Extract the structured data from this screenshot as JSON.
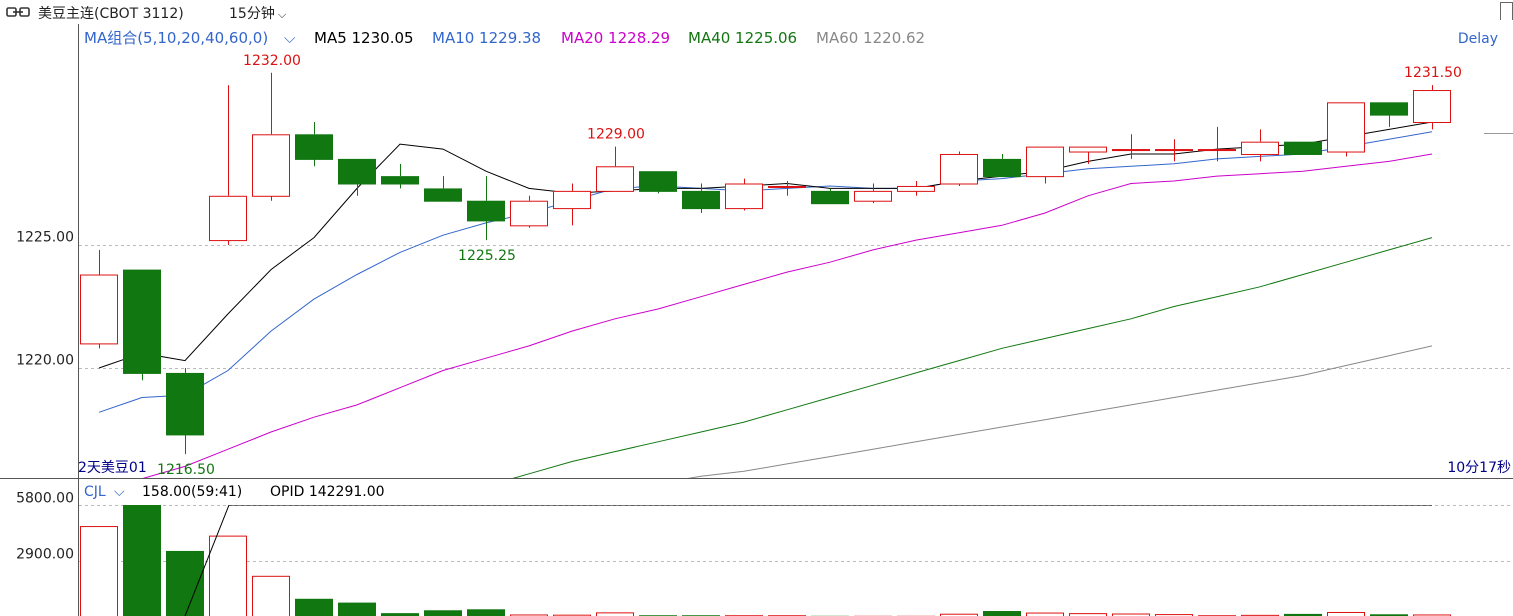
{
  "topbar": {
    "contract_title": "美豆主连(CBOT 3112)",
    "period_label": "15分钟",
    "period_chevron": "⌵",
    "link_icon": "link-icon"
  },
  "colors": {
    "up": "#dd1111",
    "down": "#117711",
    "down_fill": "#117711",
    "grid": "#bbbbbb",
    "ma5": "#000000",
    "ma10": "#3366cc",
    "ma20": "#cc00cc",
    "ma40": "#117711",
    "ma60": "#888888"
  },
  "main_legend": {
    "indicator_label": "MA组合(5,10,20,40,60,0)",
    "chevron": "⌵",
    "items": [
      {
        "key": "ma5",
        "label": "MA5 1230.05",
        "color": "#000000"
      },
      {
        "key": "ma10",
        "label": "MA10 1229.38",
        "color": "#3366cc"
      },
      {
        "key": "ma20",
        "label": "MA20 1228.29",
        "color": "#cc00cc"
      },
      {
        "key": "ma40",
        "label": "MA40 1225.06",
        "color": "#117711"
      },
      {
        "key": "ma60",
        "label": "MA60 1220.62",
        "color": "#888888"
      }
    ],
    "delay_label": "Delay"
  },
  "main_footer": {
    "left_label": "2天美豆01",
    "right_label": "10分17秒"
  },
  "sub_legend": {
    "indicator_label": "CJL",
    "chevron": "⌵",
    "value_text": "158.00(59:41)",
    "opid_text": "OPID 142291.00"
  },
  "chart_data": [
    {
      "type": "candlestick",
      "y_ticks": [
        "1225.00",
        "1220.00"
      ],
      "ylim": [
        1215.5,
        1233.0
      ],
      "annotations": [
        {
          "index": 4,
          "text": "1232.00",
          "kind": "high"
        },
        {
          "index": 9,
          "text": "1225.25",
          "kind": "low"
        },
        {
          "index": 12,
          "text": "1229.00",
          "kind": "high"
        },
        {
          "index": 31,
          "text": "1231.50",
          "kind": "high"
        },
        {
          "index": 2,
          "text": "1216.50",
          "kind": "low"
        }
      ],
      "candles": [
        {
          "o": 1221.0,
          "h": 1224.8,
          "l": 1220.8,
          "c": 1223.8
        },
        {
          "o": 1224.0,
          "h": 1224.0,
          "l": 1219.5,
          "c": 1219.8
        },
        {
          "o": 1219.8,
          "h": 1220.0,
          "l": 1216.5,
          "c": 1217.3
        },
        {
          "o": 1225.2,
          "h": 1231.5,
          "l": 1225.0,
          "c": 1227.0
        },
        {
          "o": 1227.0,
          "h": 1232.0,
          "l": 1226.8,
          "c": 1229.5
        },
        {
          "o": 1229.5,
          "h": 1230.0,
          "l": 1228.2,
          "c": 1228.5
        },
        {
          "o": 1228.5,
          "h": 1228.5,
          "l": 1227.0,
          "c": 1227.5
        },
        {
          "o": 1227.8,
          "h": 1228.3,
          "l": 1227.3,
          "c": 1227.5
        },
        {
          "o": 1227.3,
          "h": 1227.8,
          "l": 1226.8,
          "c": 1226.8
        },
        {
          "o": 1226.8,
          "h": 1227.8,
          "l": 1225.2,
          "c": 1226.0
        },
        {
          "o": 1225.8,
          "h": 1227.0,
          "l": 1225.7,
          "c": 1226.8
        },
        {
          "o": 1226.5,
          "h": 1227.5,
          "l": 1225.8,
          "c": 1227.2
        },
        {
          "o": 1227.2,
          "h": 1229.0,
          "l": 1227.2,
          "c": 1228.2
        },
        {
          "o": 1228.0,
          "h": 1228.0,
          "l": 1227.1,
          "c": 1227.2
        },
        {
          "o": 1227.2,
          "h": 1227.5,
          "l": 1226.3,
          "c": 1226.5
        },
        {
          "o": 1226.5,
          "h": 1227.7,
          "l": 1226.4,
          "c": 1227.5
        },
        {
          "o": 1227.4,
          "h": 1227.6,
          "l": 1227.0,
          "c": 1227.4
        },
        {
          "o": 1227.2,
          "h": 1227.3,
          "l": 1226.7,
          "c": 1226.7
        },
        {
          "o": 1226.8,
          "h": 1227.5,
          "l": 1226.7,
          "c": 1227.2
        },
        {
          "o": 1227.2,
          "h": 1227.6,
          "l": 1227.0,
          "c": 1227.4
        },
        {
          "o": 1227.5,
          "h": 1228.8,
          "l": 1227.4,
          "c": 1228.7
        },
        {
          "o": 1228.5,
          "h": 1228.7,
          "l": 1227.8,
          "c": 1227.8
        },
        {
          "o": 1227.8,
          "h": 1229.0,
          "l": 1227.5,
          "c": 1229.0
        },
        {
          "o": 1228.8,
          "h": 1229.0,
          "l": 1228.3,
          "c": 1229.0
        },
        {
          "o": 1228.9,
          "h": 1229.5,
          "l": 1228.5,
          "c": 1228.9
        },
        {
          "o": 1228.9,
          "h": 1229.3,
          "l": 1228.4,
          "c": 1228.9
        },
        {
          "o": 1228.9,
          "h": 1229.8,
          "l": 1228.4,
          "c": 1228.9
        },
        {
          "o": 1228.7,
          "h": 1229.7,
          "l": 1228.4,
          "c": 1229.2
        },
        {
          "o": 1229.2,
          "h": 1229.2,
          "l": 1228.7,
          "c": 1228.7
        },
        {
          "o": 1228.8,
          "h": 1230.8,
          "l": 1228.6,
          "c": 1230.8
        },
        {
          "o": 1230.8,
          "h": 1230.8,
          "l": 1229.8,
          "c": 1230.3
        },
        {
          "o": 1230.0,
          "h": 1231.5,
          "l": 1229.7,
          "c": 1231.3
        }
      ],
      "ma": {
        "ma5": [
          1220.0,
          1220.6,
          1220.3,
          1222.2,
          1224.0,
          1225.3,
          1227.3,
          1229.1,
          1228.9,
          1228.0,
          1227.3,
          1227.1,
          1227.2,
          1227.3,
          1227.3,
          1227.4,
          1227.5,
          1227.3,
          1227.3,
          1227.3,
          1227.6,
          1227.8,
          1228.0,
          1228.4,
          1228.7,
          1228.7,
          1228.9,
          1229.0,
          1229.1,
          1229.4,
          1229.7,
          1230.0
        ],
        "ma10": [
          1218.2,
          1218.8,
          1218.9,
          1219.9,
          1221.5,
          1222.8,
          1223.8,
          1224.7,
          1225.4,
          1225.9,
          1226.3,
          1226.8,
          1227.3,
          1227.4,
          1227.3,
          1227.2,
          1227.3,
          1227.4,
          1227.3,
          1227.3,
          1227.6,
          1227.7,
          1227.9,
          1228.1,
          1228.2,
          1228.3,
          1228.5,
          1228.6,
          1228.7,
          1229.0,
          1229.3,
          1229.6
        ],
        "ma20": [
          1214.9,
          1215.5,
          1216.0,
          1216.7,
          1217.4,
          1218.0,
          1218.5,
          1219.2,
          1219.9,
          1220.4,
          1220.9,
          1221.5,
          1222.0,
          1222.4,
          1222.9,
          1223.4,
          1223.9,
          1224.3,
          1224.8,
          1225.2,
          1225.5,
          1225.8,
          1226.3,
          1227.0,
          1227.5,
          1227.6,
          1227.8,
          1227.9,
          1228.0,
          1228.2,
          1228.4,
          1228.7
        ],
        "ma40": [
          1212.0,
          1212.5,
          1212.9,
          1213.2,
          1213.5,
          1213.7,
          1214.0,
          1214.4,
          1214.8,
          1215.2,
          1215.7,
          1216.2,
          1216.6,
          1217.0,
          1217.4,
          1217.8,
          1218.3,
          1218.8,
          1219.3,
          1219.8,
          1220.3,
          1220.8,
          1221.2,
          1221.6,
          1222.0,
          1222.5,
          1222.9,
          1223.3,
          1223.8,
          1224.3,
          1224.8,
          1225.3
        ],
        "ma60": [
          1210.5,
          1211.0,
          1211.5,
          1211.9,
          1212.3,
          1212.7,
          1213.1,
          1213.5,
          1213.8,
          1214.1,
          1214.4,
          1214.7,
          1215.0,
          1215.3,
          1215.6,
          1215.8,
          1216.1,
          1216.4,
          1216.7,
          1217.0,
          1217.3,
          1217.6,
          1217.9,
          1218.2,
          1218.5,
          1218.8,
          1219.1,
          1219.4,
          1219.7,
          1220.1,
          1220.5,
          1220.9
        ]
      }
    },
    {
      "type": "bar",
      "series_name": "CJL",
      "y_ticks": [
        "5800.00",
        "2900.00"
      ],
      "ylim": [
        0,
        5800
      ],
      "values": [
        4700,
        6500,
        3400,
        4200,
        2100,
        900,
        700,
        150,
        300,
        350,
        80,
        70,
        190,
        40,
        40,
        40,
        40,
        10,
        10,
        10,
        120,
        260,
        180,
        150,
        130,
        100,
        40,
        60,
        110,
        210,
        90,
        80
      ],
      "opid_line": {
        "start_index": 2,
        "value": 5800
      }
    }
  ]
}
